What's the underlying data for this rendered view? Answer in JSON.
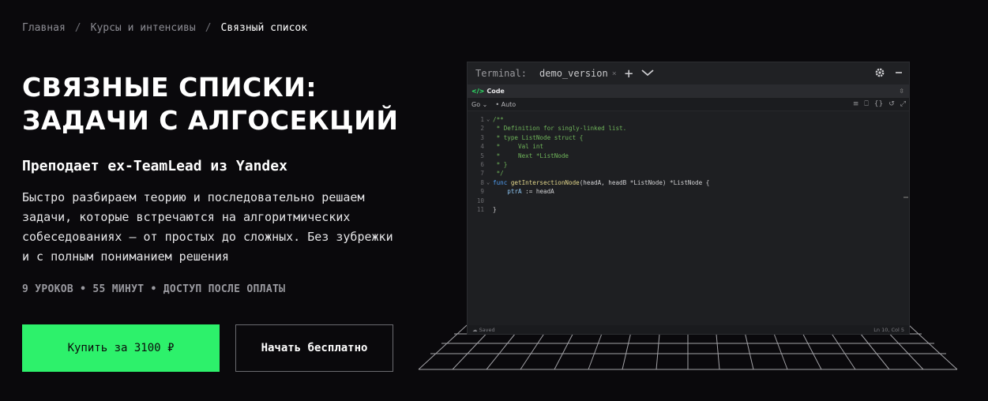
{
  "breadcrumb": {
    "home": "Главная",
    "courses": "Курсы и интенсивы",
    "current": "Связный список",
    "separator": "/"
  },
  "hero": {
    "title_line1": "СВЯЗНЫЕ СПИСКИ:",
    "title_line2": "ЗАДАЧИ С АЛГОСЕКЦИЙ",
    "subtitle": "Преподает ex-TeamLead из Yandex",
    "description": "Быстро разбираем теорию и последовательно решаем задачи, которые встречаются на алгоритмических собеседованиях — от простых до сложных. Без зубрежки и с полным пониманием решения",
    "meta": "9 УРОКОВ • 55 МИНУТ • ДОСТУП ПОСЛЕ ОПЛАТЫ"
  },
  "buttons": {
    "buy": "Купить за 3100 ₽",
    "free": "Начать бесплатно"
  },
  "colors": {
    "accent": "#2df16b",
    "background": "#0a090c"
  },
  "editor": {
    "terminal_label": "Terminal:",
    "tab_name": "demo_version",
    "tab_close": "×",
    "add": "+",
    "panel_title": "Code",
    "language": "Go",
    "mode": "Auto",
    "status_left": "Saved",
    "status_right": "Ln 10, Col 5",
    "icons": [
      "code-icon",
      "gear-icon",
      "minimize-icon",
      "chevron-down-icon",
      "plus-icon",
      "expand-icon",
      "format-icon",
      "bookmark-icon",
      "braces-icon",
      "undo-icon",
      "fullscreen-icon",
      "cloud-icon"
    ],
    "lines": [
      {
        "n": "1",
        "fold": "⌄",
        "parts": [
          {
            "t": "/**",
            "c": "c-comment"
          }
        ]
      },
      {
        "n": "2",
        "fold": "",
        "parts": [
          {
            "t": " * Definition for singly-linked list.",
            "c": "c-comment"
          }
        ]
      },
      {
        "n": "3",
        "fold": "",
        "parts": [
          {
            "t": " * type ListNode struct {",
            "c": "c-comment"
          }
        ]
      },
      {
        "n": "4",
        "fold": "",
        "parts": [
          {
            "t": " *     Val int",
            "c": "c-comment"
          }
        ]
      },
      {
        "n": "5",
        "fold": "",
        "parts": [
          {
            "t": " *     Next *ListNode",
            "c": "c-comment"
          }
        ]
      },
      {
        "n": "6",
        "fold": "",
        "parts": [
          {
            "t": " * }",
            "c": "c-comment"
          }
        ]
      },
      {
        "n": "7",
        "fold": "",
        "parts": [
          {
            "t": " */",
            "c": "c-comment"
          }
        ]
      },
      {
        "n": "8",
        "fold": "⌄",
        "parts": [
          {
            "t": "func ",
            "c": "c-kw"
          },
          {
            "t": "getIntersectionNode",
            "c": "c-fn"
          },
          {
            "t": "(headA, headB *ListNode) *ListNode {",
            "c": "c-id"
          }
        ]
      },
      {
        "n": "9",
        "fold": "",
        "parts": [
          {
            "t": "    ",
            "c": "c-id"
          },
          {
            "t": "ptrA",
            "c": "c-var"
          },
          {
            "t": " := headA",
            "c": "c-id"
          }
        ]
      },
      {
        "n": "10",
        "fold": "",
        "parts": [
          {
            "t": "",
            "c": "c-id"
          }
        ]
      },
      {
        "n": "11",
        "fold": "",
        "parts": [
          {
            "t": "}",
            "c": "c-id"
          }
        ]
      }
    ]
  }
}
